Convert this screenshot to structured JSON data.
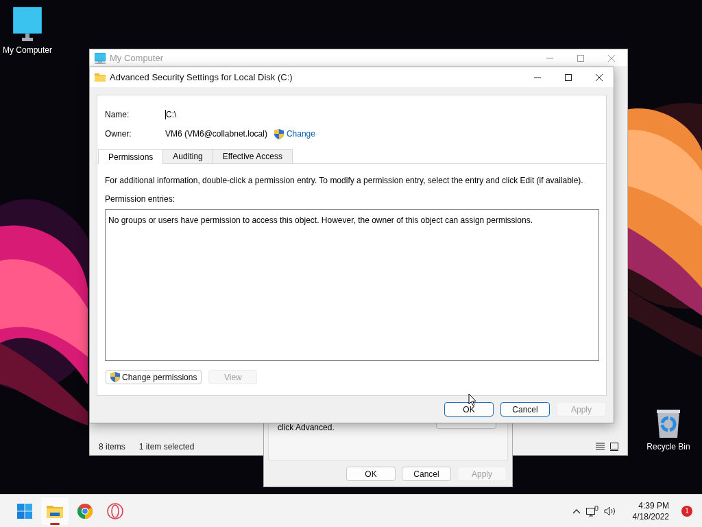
{
  "desktop_icons": [
    {
      "kind": "computer",
      "label": "My Computer"
    },
    {
      "kind": "recycle",
      "label": "Recycle Bin"
    }
  ],
  "explorer_window": {
    "title": "My Computer",
    "status_bar": {
      "item_count": "8 items",
      "selection": "1 item selected"
    }
  },
  "properties_dialog": {
    "text": "click Advanced.",
    "buttons": [
      {
        "label": "OK",
        "disabled": false
      },
      {
        "label": "Cancel",
        "disabled": false
      },
      {
        "label": "Apply",
        "disabled": true
      }
    ]
  },
  "advanced_dialog": {
    "title": "Advanced Security Settings for Local Disk (C:)",
    "name_label": "Name:",
    "name_value": "C:\\",
    "owner_label": "Owner:",
    "owner_value": "VM6 (VM6@collabnet.local)",
    "change_link": "Change",
    "tabs": [
      {
        "label": "Permissions",
        "selected": true
      },
      {
        "label": "Auditing",
        "selected": false
      },
      {
        "label": "Effective Access",
        "selected": false
      }
    ],
    "info": "For additional information, double-click a permission entry. To modify a permission entry, select the entry and click Edit (if available).",
    "entries_label": "Permission entries:",
    "entries_message": "No groups or users have permission to access this object. However, the owner of this object can assign permissions.",
    "entry_buttons": [
      {
        "label": "Change permissions",
        "shield": true,
        "disabled": false
      },
      {
        "label": "View",
        "shield": false,
        "disabled": true
      }
    ],
    "buttons": [
      {
        "label": "OK",
        "disabled": false
      },
      {
        "label": "Cancel",
        "disabled": false
      },
      {
        "label": "Apply",
        "disabled": true
      }
    ]
  },
  "taskbar": {
    "apps": [
      {
        "kind": "start",
        "running": false
      },
      {
        "kind": "explorer",
        "running": true
      },
      {
        "kind": "chrome",
        "running": false
      },
      {
        "kind": "opera",
        "running": false
      }
    ],
    "time": "4:39 PM",
    "date": "4/18/2022",
    "notification_count": "1"
  }
}
